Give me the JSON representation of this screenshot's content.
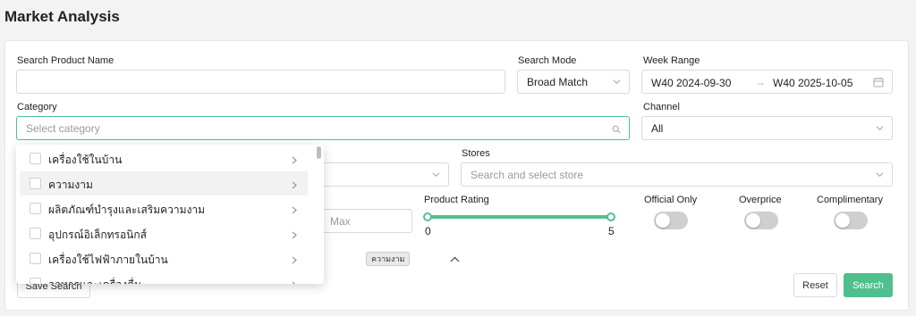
{
  "page": {
    "title": "Market Analysis"
  },
  "search_product": {
    "label": "Search Product Name",
    "value": ""
  },
  "search_mode": {
    "label": "Search Mode",
    "value": "Broad Match"
  },
  "week_range": {
    "label": "Week Range",
    "start": "W40 2024-09-30",
    "end": "W40 2025-10-05"
  },
  "category": {
    "label": "Category",
    "placeholder": "Select category"
  },
  "channel": {
    "label": "Channel",
    "value": "All"
  },
  "stores": {
    "label": "Stores",
    "placeholder": "Search and select store"
  },
  "price": {
    "max_placeholder": "Max"
  },
  "product_rating": {
    "label": "Product Rating",
    "min": "0",
    "max": "5"
  },
  "toggles": {
    "official_only": "Official Only",
    "overprice": "Overprice",
    "complimentary": "Complimentary"
  },
  "dropdown": {
    "items": [
      "เครื่องใช้ในบ้าน",
      "ความงาม",
      "ผลิตภัณฑ์บำรุงและเสริมความงาม",
      "อุปกรณ์อิเล็กทรอนิกส์",
      "เครื่องใช้ไฟฟ้าภายในบ้าน",
      "อาหารและเครื่องดื่ม"
    ]
  },
  "tooltip": {
    "text": "ความงาม"
  },
  "buttons": {
    "save_search": "Save Search",
    "reset": "Reset",
    "search": "Search"
  },
  "colors": {
    "accent": "#4fc08d"
  }
}
